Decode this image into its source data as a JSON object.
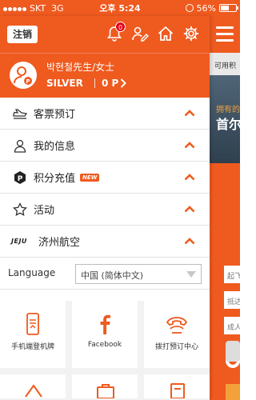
{
  "status": {
    "carrier": "SKT",
    "network": "3G",
    "time": "오후 5:24",
    "battery": "56%",
    "battery_level": 0.56
  },
  "header": {
    "logout_label": "注销",
    "notification_count": "0"
  },
  "profile": {
    "name": "박현철先生/女士",
    "level": "SILVER",
    "points": "0 P"
  },
  "menu": {
    "items": [
      {
        "label": "客票预订"
      },
      {
        "label": "我的信息"
      },
      {
        "label": "积分充值",
        "badge": "NEW"
      },
      {
        "label": "活动"
      },
      {
        "label": "济州航空",
        "logo": "JEJU"
      }
    ]
  },
  "language": {
    "label": "Language",
    "selected": "中国 (简体中文)"
  },
  "quick": [
    {
      "label": "手机端登机牌"
    },
    {
      "label": "Facebook"
    },
    {
      "label": "拨打预订中心"
    }
  ],
  "background": {
    "band_text": "可用积",
    "photo_small": "拥有的",
    "photo_big": "首尔",
    "field1": "起飞",
    "field2": "抵达",
    "field3": "成人"
  },
  "colors": {
    "brand": "#ef5a1f",
    "accent": "#f2a13b"
  }
}
